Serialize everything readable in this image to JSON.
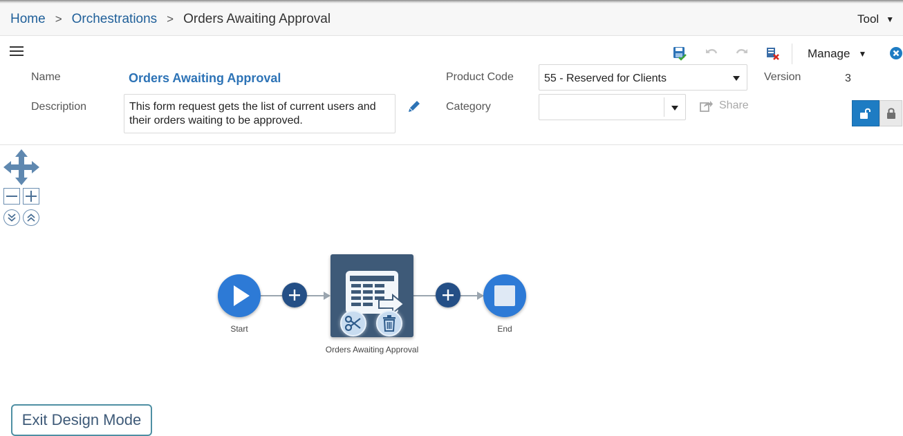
{
  "breadcrumb": {
    "home": "Home",
    "sep1": ">",
    "orchestrations": "Orchestrations",
    "sep2": ">",
    "current": "Orders Awaiting Approval"
  },
  "tools": {
    "label": "Tool",
    "caret": "▼"
  },
  "toolbar": {
    "icons": [
      "save-icon",
      "undo-icon",
      "redo-icon",
      "delete-icon"
    ],
    "manage_label": "Manage",
    "manage_caret": "▼",
    "close_icon": "close-icon"
  },
  "form": {
    "name_label": "Name",
    "name_value": "Orders Awaiting Approval",
    "description_label": "Description",
    "description_value": "This form request gets the list of current users and their orders waiting to be approved.",
    "product_code_label": "Product Code",
    "product_code_value": "55 - Reserved for Clients",
    "category_label": "Category",
    "category_value": "",
    "version_label": "Version",
    "version_value": "3",
    "share_label": "Share"
  },
  "flow": {
    "start_label": "Start",
    "step_label": "Orders Awaiting Approval",
    "end_label": "End"
  },
  "colors": {
    "link": "#1f5f99",
    "accent": "#2d7ad6",
    "plus": "#244f86",
    "step": "#3e5a78",
    "lock_active": "#1e7cc3"
  },
  "exit_button": {
    "label": "Exit Design Mode"
  }
}
